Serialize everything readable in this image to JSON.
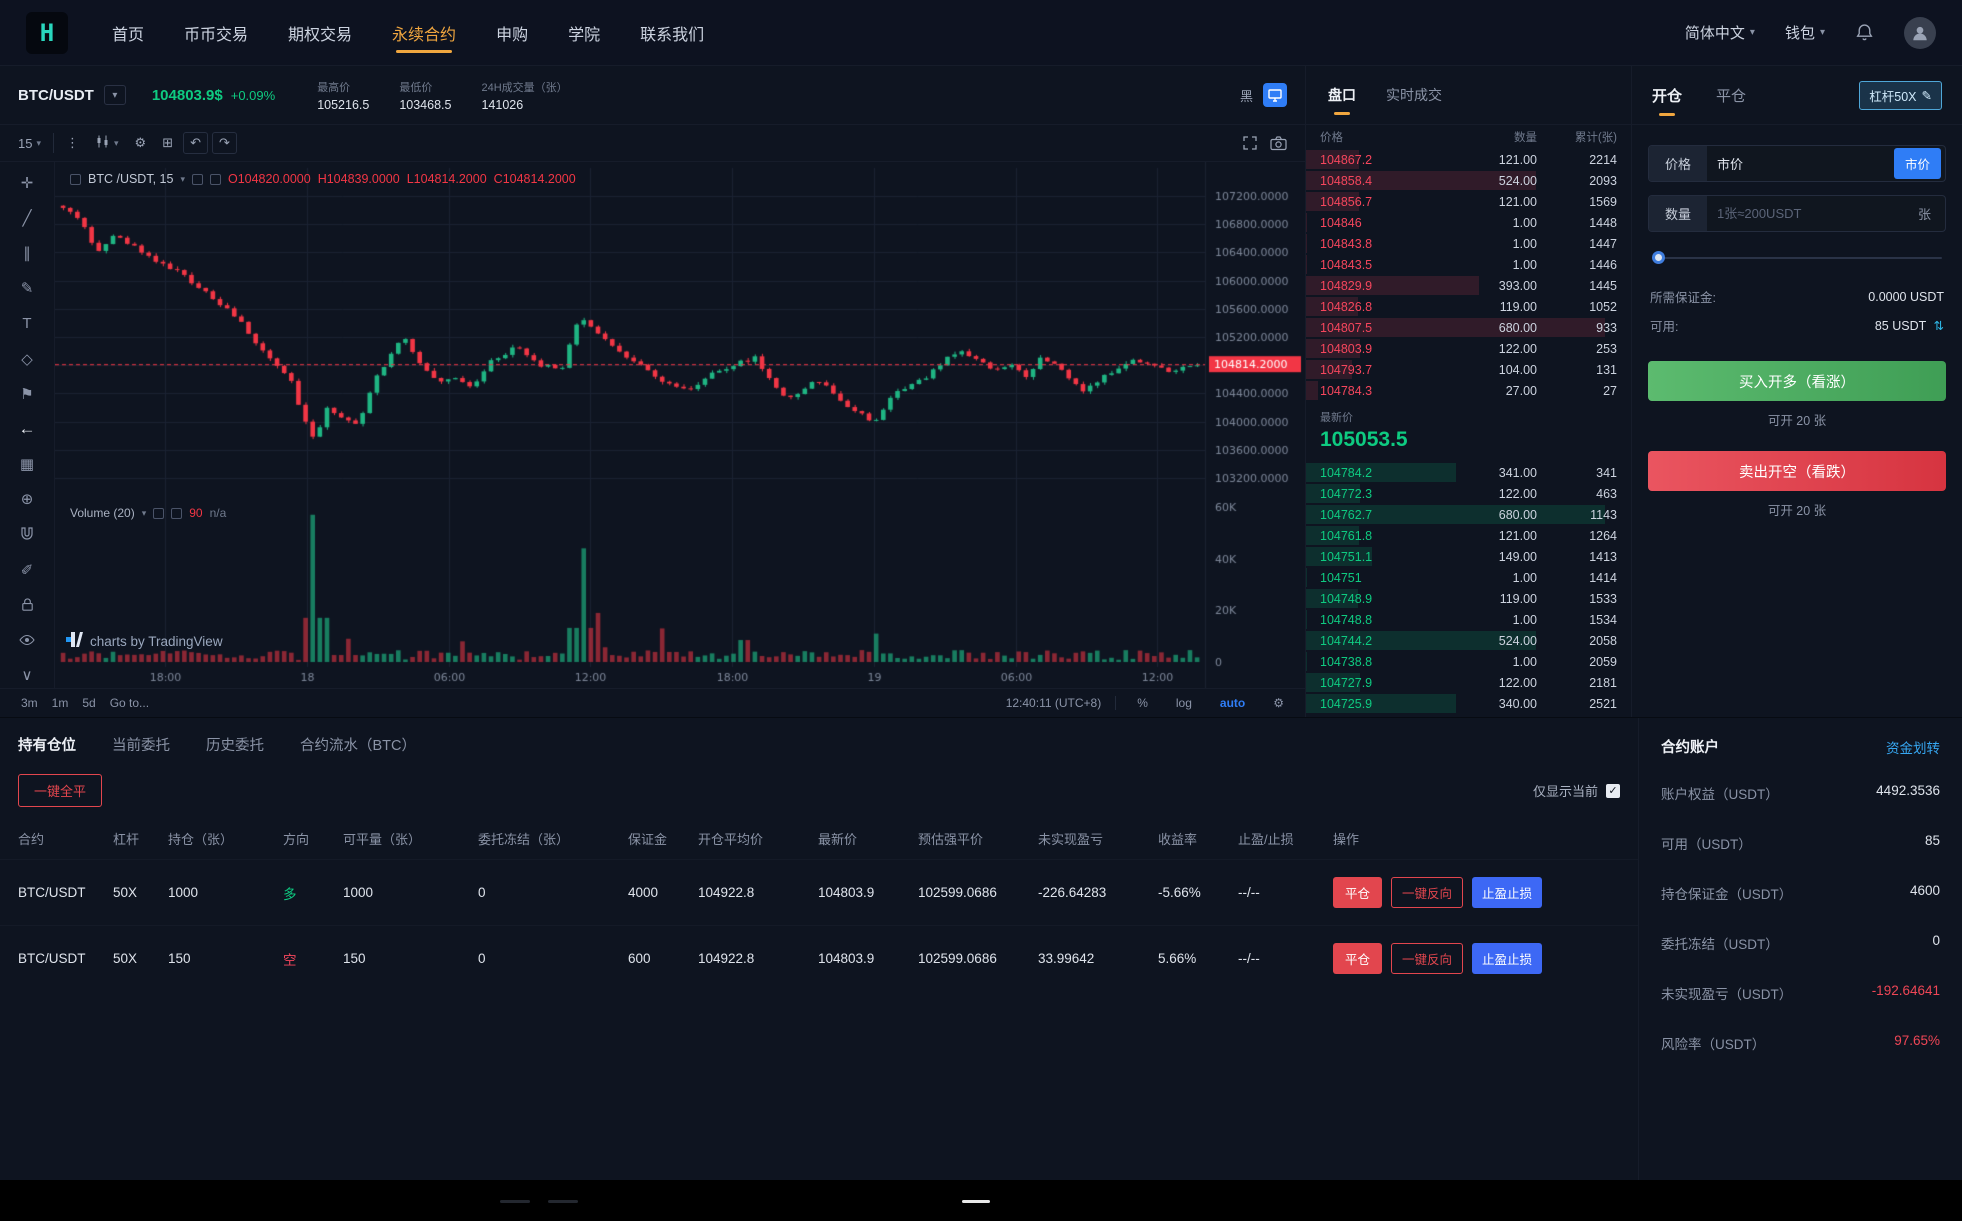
{
  "icons": {
    "caret-down": "▾",
    "kebab": "⋮",
    "gear": "⚙",
    "compare": "⊞",
    "undo": "↶",
    "redo": "↷",
    "crosshair": "✛",
    "trendline": "╱",
    "channels": "∥",
    "brush": "✎",
    "text": "T",
    "pattern": "◇",
    "forecast": "⚑",
    "arrow-left": "←",
    "bars-pattern": "▦",
    "zoom": "⊕",
    "edit": "✐",
    "chevron-down": "∨",
    "swap": "⇅",
    "pencil": "✎",
    "check": "✓"
  },
  "navbar": {
    "logo_text": "H",
    "items": [
      {
        "label": "首页",
        "active": false
      },
      {
        "label": "币币交易",
        "active": false
      },
      {
        "label": "期权交易",
        "active": false
      },
      {
        "label": "永续合约",
        "active": true
      },
      {
        "label": "申购",
        "active": false
      },
      {
        "label": "学院",
        "active": false
      },
      {
        "label": "联系我们",
        "active": false
      }
    ],
    "language": "简体中文",
    "wallet": "钱包"
  },
  "symbol_bar": {
    "pair": "BTC/USDT",
    "price": "104803.9$",
    "change": "+0.09%",
    "stats": [
      {
        "label": "最高价",
        "value": "105216.5"
      },
      {
        "label": "最低价",
        "value": "103468.5"
      },
      {
        "label": "24H成交量（张）",
        "value": "141026"
      }
    ],
    "theme_label": "黑"
  },
  "chart": {
    "toolbar": {
      "interval": "15"
    },
    "legend": {
      "title": "BTC /USDT, 15",
      "o": "O104820.0000",
      "h": "H104839.0000",
      "l": "L104814.2000",
      "c": "C104814.2000"
    },
    "volume_legend": {
      "title": "Volume (20)",
      "value": "90",
      "ma": "n/a"
    },
    "watermark": "charts by TradingView",
    "left_tools": [
      "crosshair",
      "trendline",
      "channels",
      "brush",
      "text",
      "pattern",
      "forecast",
      "arrow-left",
      "bars-pattern",
      "zoom",
      "magnet",
      "edit",
      "lock",
      "eye",
      "chevron-down"
    ],
    "bottom": {
      "ranges": [
        "3m",
        "1m",
        "5d",
        "Go to..."
      ],
      "clock": "12:40:11 (UTC+8)",
      "pct": "%",
      "log": "log",
      "auto": "auto"
    }
  },
  "chart_data": {
    "type": "candlestick",
    "symbol": "BTC/USDT",
    "interval": "15",
    "ohlc": {
      "open": 104820.0,
      "high": 104839.0,
      "low": 104814.2,
      "close": 104814.2
    },
    "last_price": 104814.2,
    "price_ticks": [
      107200,
      106800,
      106400,
      106000,
      105600,
      105200,
      104800,
      104400,
      104000,
      103600,
      103200
    ],
    "price_range": {
      "min": 103000,
      "max": 107400
    },
    "time_ticks": [
      "18:00",
      "18",
      "06:00",
      "12:00",
      "18:00",
      "19",
      "06:00",
      "12:00"
    ],
    "volume_ticks": [
      {
        "label": "60K",
        "value": 60000
      },
      {
        "label": "40K",
        "value": 40000
      },
      {
        "label": "20K",
        "value": 20000
      },
      {
        "label": "0",
        "value": 0
      }
    ],
    "volume_max": 60000,
    "candle_count": 160,
    "seed": 9,
    "anchors": [
      [
        0.0,
        107050
      ],
      [
        0.015,
        106850
      ],
      [
        0.03,
        106400
      ],
      [
        0.045,
        106650
      ],
      [
        0.06,
        106500
      ],
      [
        0.08,
        106300
      ],
      [
        0.1,
        106150
      ],
      [
        0.12,
        105900
      ],
      [
        0.14,
        105650
      ],
      [
        0.16,
        105350
      ],
      [
        0.18,
        104900
      ],
      [
        0.2,
        104650
      ],
      [
        0.21,
        104100
      ],
      [
        0.222,
        103700
      ],
      [
        0.232,
        104200
      ],
      [
        0.245,
        104050
      ],
      [
        0.26,
        103950
      ],
      [
        0.272,
        104500
      ],
      [
        0.285,
        104850
      ],
      [
        0.3,
        105200
      ],
      [
        0.315,
        104800
      ],
      [
        0.33,
        104550
      ],
      [
        0.345,
        104600
      ],
      [
        0.36,
        104500
      ],
      [
        0.38,
        104900
      ],
      [
        0.4,
        105050
      ],
      [
        0.42,
        104800
      ],
      [
        0.44,
        104750
      ],
      [
        0.455,
        105500
      ],
      [
        0.47,
        105250
      ],
      [
        0.49,
        105000
      ],
      [
        0.51,
        104800
      ],
      [
        0.53,
        104550
      ],
      [
        0.55,
        104450
      ],
      [
        0.57,
        104650
      ],
      [
        0.59,
        104800
      ],
      [
        0.61,
        104900
      ],
      [
        0.625,
        104550
      ],
      [
        0.64,
        104300
      ],
      [
        0.655,
        104500
      ],
      [
        0.67,
        104600
      ],
      [
        0.685,
        104300
      ],
      [
        0.7,
        104150
      ],
      [
        0.715,
        103950
      ],
      [
        0.73,
        104350
      ],
      [
        0.745,
        104500
      ],
      [
        0.76,
        104600
      ],
      [
        0.775,
        104850
      ],
      [
        0.79,
        105000
      ],
      [
        0.805,
        104900
      ],
      [
        0.82,
        104750
      ],
      [
        0.835,
        104800
      ],
      [
        0.85,
        104650
      ],
      [
        0.862,
        104900
      ],
      [
        0.875,
        104800
      ],
      [
        0.888,
        104600
      ],
      [
        0.9,
        104450
      ],
      [
        0.915,
        104600
      ],
      [
        0.93,
        104750
      ],
      [
        0.945,
        104900
      ],
      [
        0.96,
        104800
      ],
      [
        0.975,
        104700
      ],
      [
        0.99,
        104780
      ],
      [
        1.0,
        104814
      ]
    ],
    "volume_spikes": [
      [
        0.222,
        57000
      ],
      [
        0.458,
        44000
      ],
      [
        0.47,
        19000
      ],
      [
        0.53,
        13000
      ],
      [
        0.6,
        8500
      ],
      [
        0.718,
        11000
      ],
      [
        0.25,
        9000
      ],
      [
        0.35,
        8000
      ]
    ],
    "colors": {
      "up": "#1fb583",
      "down": "#f23645",
      "grid": "#1a2232",
      "axis_text": "#7d8799",
      "last_line": "#f23645"
    }
  },
  "orderbook": {
    "tabs": [
      {
        "label": "盘口",
        "active": true
      },
      {
        "label": "实时成交",
        "active": false
      }
    ],
    "headers": [
      "价格",
      "数量",
      "累计(张)"
    ],
    "max_qty": 680,
    "asks": [
      [
        "104867.2",
        "121.00",
        "2214"
      ],
      [
        "104858.4",
        "524.00",
        "2093"
      ],
      [
        "104856.7",
        "121.00",
        "1569"
      ],
      [
        "104846",
        "1.00",
        "1448"
      ],
      [
        "104843.8",
        "1.00",
        "1447"
      ],
      [
        "104843.5",
        "1.00",
        "1446"
      ],
      [
        "104829.9",
        "393.00",
        "1445"
      ],
      [
        "104826.8",
        "119.00",
        "1052"
      ],
      [
        "104807.5",
        "680.00",
        "933"
      ],
      [
        "104803.9",
        "122.00",
        "253"
      ],
      [
        "104793.7",
        "104.00",
        "131"
      ],
      [
        "104784.3",
        "27.00",
        "27"
      ]
    ],
    "last_label": "最新价",
    "last_price": "105053.5",
    "bids": [
      [
        "104784.2",
        "341.00",
        "341"
      ],
      [
        "104772.3",
        "122.00",
        "463"
      ],
      [
        "104762.7",
        "680.00",
        "1143"
      ],
      [
        "104761.8",
        "121.00",
        "1264"
      ],
      [
        "104751.1",
        "149.00",
        "1413"
      ],
      [
        "104751",
        "1.00",
        "1414"
      ],
      [
        "104748.9",
        "119.00",
        "1533"
      ],
      [
        "104748.8",
        "1.00",
        "1534"
      ],
      [
        "104744.2",
        "524.00",
        "2058"
      ],
      [
        "104738.8",
        "1.00",
        "2059"
      ],
      [
        "104727.9",
        "122.00",
        "2181"
      ],
      [
        "104725.9",
        "340.00",
        "2521"
      ]
    ]
  },
  "trade_panel": {
    "tabs": [
      {
        "label": "开仓",
        "active": true
      },
      {
        "label": "平仓",
        "active": false
      }
    ],
    "leverage": "杠杆50X",
    "price_label": "价格",
    "price_value": "市价",
    "market_btn": "市价",
    "qty_label": "数量",
    "qty_placeholder": "1张≈200USDT",
    "qty_unit": "张",
    "margin_label": "所需保证金:",
    "margin_value": "0.0000 USDT",
    "avail_label": "可用:",
    "avail_value": "85 USDT",
    "buy_btn": "买入开多（看涨）",
    "buy_hint": "可开 20 张",
    "sell_btn": "卖出开空（看跌）",
    "sell_hint": "可开 20 张"
  },
  "positions": {
    "tabs": [
      {
        "label": "持有仓位",
        "active": true
      },
      {
        "label": "当前委托",
        "active": false
      },
      {
        "label": "历史委托",
        "active": false
      },
      {
        "label": "合约流水（BTC）",
        "active": false
      }
    ],
    "close_all": "一键全平",
    "only_current": "仅显示当前",
    "headers": [
      "合约",
      "杠杆",
      "持仓（张）",
      "方向",
      "可平量（张）",
      "委托冻结（张）",
      "保证金",
      "开仓平均价",
      "最新价",
      "预估强平价",
      "未实现盈亏",
      "收益率",
      "止盈/止损",
      "操作"
    ],
    "actions": [
      "平仓",
      "一键反向",
      "止盈止损"
    ],
    "rows": [
      {
        "contract": "BTC/USDT",
        "lev": "50X",
        "pos": "1000",
        "dir": "多",
        "dir_side": "long",
        "avail": "1000",
        "frozen": "0",
        "margin": "4000",
        "avg": "104922.8",
        "last": "104803.9",
        "liq": "102599.0686",
        "pnl": "-226.64283",
        "roe": "-5.66%",
        "tpsl": "--/--"
      },
      {
        "contract": "BTC/USDT",
        "lev": "50X",
        "pos": "150",
        "dir": "空",
        "dir_side": "short",
        "avail": "150",
        "frozen": "0",
        "margin": "600",
        "avg": "104922.8",
        "last": "104803.9",
        "liq": "102599.0686",
        "pnl": "33.99642",
        "roe": "5.66%",
        "tpsl": "--/--"
      }
    ]
  },
  "account": {
    "title": "合约账户",
    "transfer": "资金划转",
    "rows": [
      {
        "label": "账户权益（USDT）",
        "value": "4492.3536",
        "color": ""
      },
      {
        "label": "可用（USDT）",
        "value": "85",
        "color": ""
      },
      {
        "label": "持仓保证金（USDT）",
        "value": "4600",
        "color": ""
      },
      {
        "label": "委托冻结（USDT）",
        "value": "0",
        "color": ""
      },
      {
        "label": "未实现盈亏（USDT）",
        "value": "-192.64641",
        "color": "#ef4656"
      },
      {
        "label": "风险率（USDT）",
        "value": "97.65%",
        "color": "#ef4656"
      }
    ]
  }
}
